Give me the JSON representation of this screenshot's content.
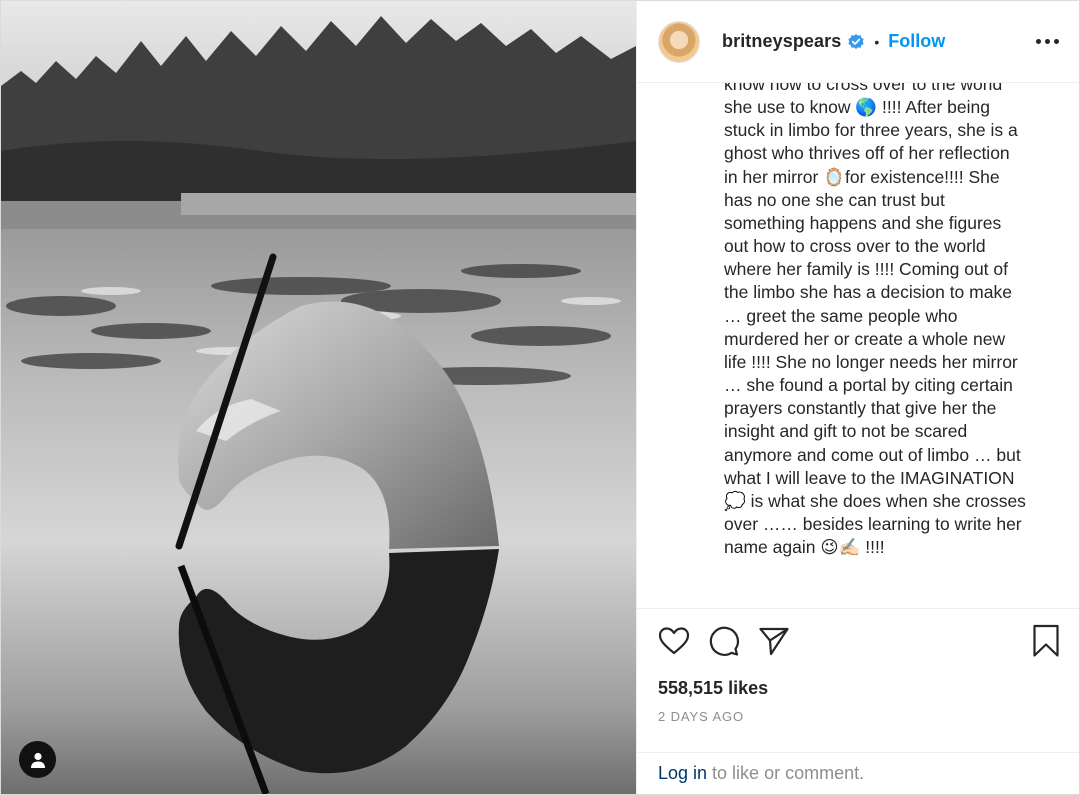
{
  "header": {
    "username": "britneyspears",
    "separator": "•",
    "follow_label": "Follow",
    "avatar_icon": "profile-photo",
    "verified_icon": "verified-badge-icon",
    "more_icon": "more-options-icon"
  },
  "caption": {
    "cut_top_line": "",
    "lines": [
      "know how to cross over to the world",
      "she use to know 🌎 !!!! After being",
      "stuck in limbo for three years, she is a",
      "ghost who thrives off of her reflection",
      "in her mirror 🪞for existence!!!! She",
      "has no one she can trust but",
      "something happens and she figures",
      "out how to cross over to the world",
      "where her family is !!!! Coming out of",
      "the limbo she has a decision to make",
      "… greet the same people who",
      "murdered her or create a whole new",
      "life !!!! She no longer needs her mirror",
      "… she found a portal by citing certain",
      "prayers constantly that give her the",
      "insight and gift to not be scared",
      "anymore and come out of limbo … but",
      "what I will leave to the IMAGINATION",
      "💭 is what she does when she crosses",
      "over …… besides learning to write her",
      "name again 😉✍🏻 !!!!"
    ]
  },
  "actions": {
    "like_icon": "heart-icon",
    "comment_icon": "comment-icon",
    "share_icon": "share-icon",
    "save_icon": "bookmark-icon"
  },
  "likes": "558,515 likes",
  "timestamp": "2 DAYS AGO",
  "login": {
    "link_label": "Log in",
    "rest_label": "to like or comment."
  },
  "photo": {
    "tag_icon": "user-tag-icon"
  },
  "colors": {
    "accent": "#0095f6",
    "link": "#00376b",
    "muted": "#8e8e8e",
    "text": "#262626"
  }
}
